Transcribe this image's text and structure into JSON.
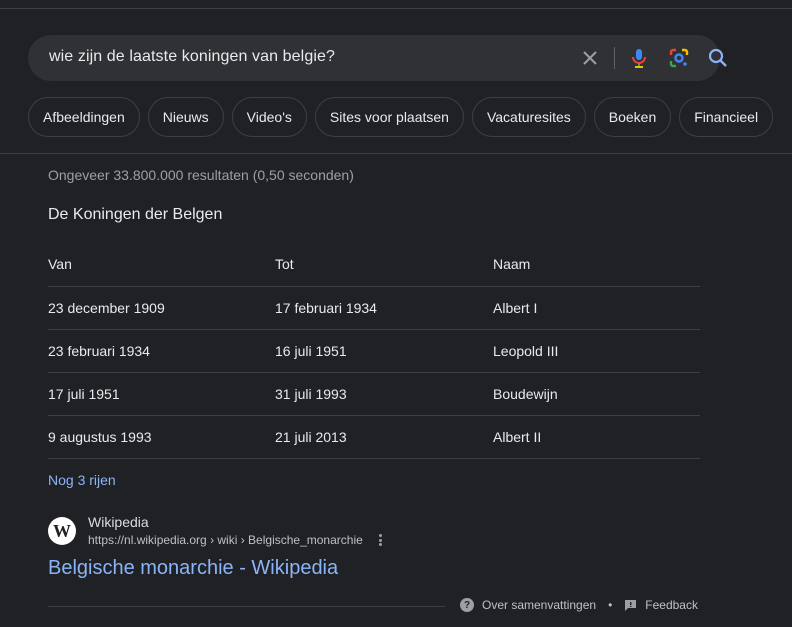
{
  "search": {
    "query": "wie zijn de laatste koningen van belgie?",
    "icons": [
      "close-icon",
      "microphone-icon",
      "google-lens-icon",
      "search-icon"
    ]
  },
  "chips": [
    "Afbeeldingen",
    "Nieuws",
    "Video's",
    "Sites voor plaatsen",
    "Vacaturesites",
    "Boeken",
    "Financieel"
  ],
  "results_stats": "Ongeveer 33.800.000 resultaten (0,50 seconden)",
  "snippet": {
    "title": "De Koningen der Belgen",
    "headers": [
      "Van",
      "Tot",
      "Naam"
    ],
    "rows": [
      [
        "23 december 1909",
        "17 februari 1934",
        "Albert I"
      ],
      [
        "23 februari 1934",
        "16 juli 1951",
        "Leopold III"
      ],
      [
        "17 juli 1951",
        "31 juli 1993",
        "Boudewijn"
      ],
      [
        "9 augustus 1993",
        "21 juli 2013",
        "Albert II"
      ]
    ],
    "more_rows": "Nog 3 rijen"
  },
  "result": {
    "favicon_letter": "W",
    "site_name": "Wikipedia",
    "url": "https://nl.wikipedia.org › wiki › Belgische_monarchie",
    "title": "Belgische monarchie - Wikipedia"
  },
  "footer": {
    "about_label": "Over samenvattingen",
    "separator": "•",
    "feedback_label": "Feedback"
  },
  "colors": {
    "background": "#202124",
    "link": "#8ab4f8",
    "searchbar": "#303134"
  }
}
